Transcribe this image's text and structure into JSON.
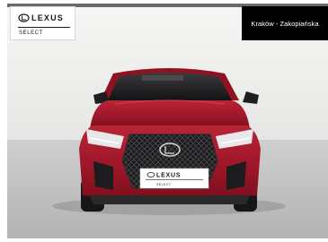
{
  "logo_badge": {
    "brand": "LEXUS",
    "subtitle": "SELECT"
  },
  "location_badge": {
    "text": "Kraków - Zakopiańska"
  },
  "plate": {
    "brand": "LEXUS",
    "subtitle": "SELECT"
  },
  "photo": {
    "subject": "red-lexus-suv-front-view",
    "car_color": "#a3182a",
    "wall_color": "#eeeeec",
    "floor_color": "#c2c2c2"
  }
}
